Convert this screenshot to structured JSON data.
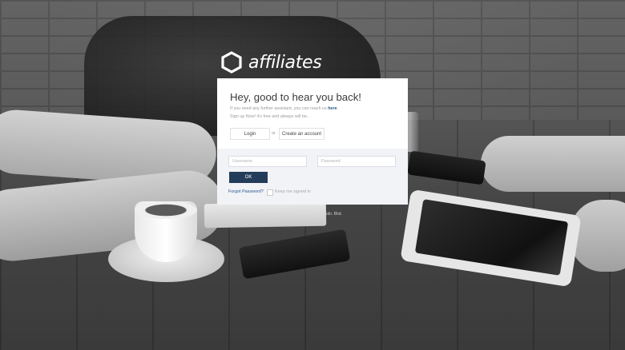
{
  "brand": {
    "name": "affiliates",
    "logo_icon": "hexagon-outline-icon"
  },
  "login_card": {
    "heading": "Hey, good to hear you back!",
    "help_text_before": "If you need any further assistant, you can reach us ",
    "help_link": "here",
    "help_text_after": ".",
    "signup_text": "Sign up Now! it's free and always will be..",
    "tabs": {
      "login": "Login",
      "or": "or",
      "create": "Create an account"
    },
    "username": {
      "value": "",
      "placeholder": "Username"
    },
    "password": {
      "value": "",
      "placeholder": "Password"
    },
    "ok_label": "OK",
    "forgot_label": "Forgot Password?",
    "keep_signed_in_label": "Keep me signed in",
    "keep_signed_in_checked": false
  },
  "background": {
    "footer_fragment": "Sdn. Bhd."
  },
  "colors": {
    "accent": "#233c5a",
    "link": "#2b5a8c",
    "card_footer": "#f1f3f7"
  }
}
